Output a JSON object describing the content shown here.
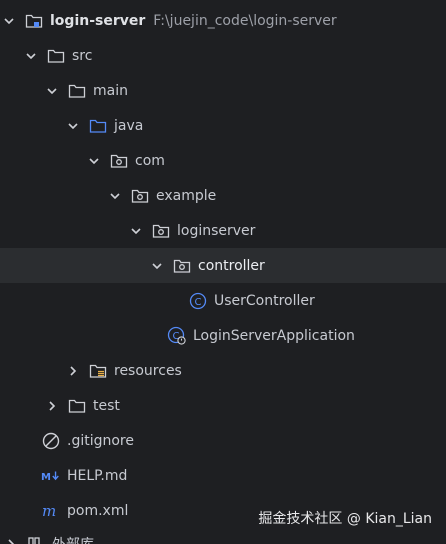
{
  "project": {
    "name": "login-server",
    "path": "F:\\juejin_code\\login-server"
  },
  "tree": {
    "src": "src",
    "main": "main",
    "java": "java",
    "com": "com",
    "example": "example",
    "loginserver": "loginserver",
    "controller": "controller",
    "user_controller": "UserController",
    "app": "LoginServerApplication",
    "resources": "resources",
    "test": "test",
    "gitignore": ".gitignore",
    "help": "HELP.md",
    "pom": "pom.xml",
    "external": "外部库"
  },
  "icons": {
    "module": "module-folder-icon",
    "folder": "folder-icon",
    "source_folder": "source-folder-icon",
    "package": "package-icon",
    "resources_folder": "resources-folder-icon",
    "class": "class-icon",
    "spring_app": "spring-boot-application-icon",
    "gitignore": "ignore-icon",
    "markdown": "markdown-icon",
    "maven": "maven-icon"
  },
  "colors": {
    "background": "#1e1f22",
    "selection": "#2b2d30",
    "class_blue": "#548af7",
    "folder_gray": "#ced0d6"
  },
  "watermark": "掘金技术社区 @ Kian_Lian"
}
